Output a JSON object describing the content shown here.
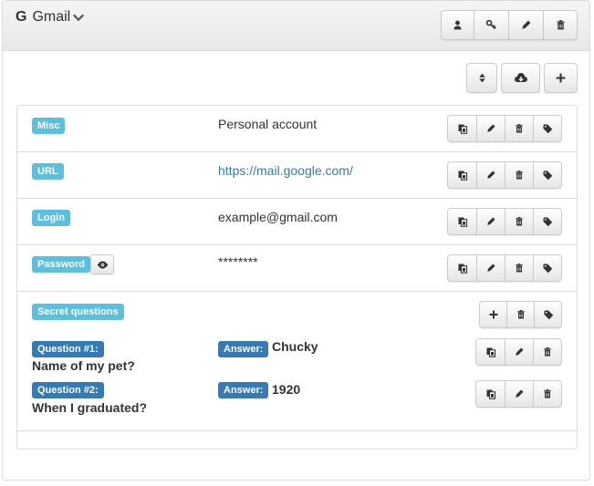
{
  "header": {
    "logo_letter": "G",
    "title": "Gmail"
  },
  "icons": {
    "header_buttons": [
      "user-icon",
      "key-icon",
      "pencil-icon",
      "trash-icon"
    ],
    "toolbar_buttons": [
      "sort-icon",
      "cloud-download-icon",
      "plus-icon"
    ],
    "row_actions": [
      "copy-icon",
      "pencil-icon",
      "trash-icon",
      "tag-icon"
    ],
    "secret_actions": [
      "plus-icon",
      "trash-icon",
      "tag-icon"
    ],
    "question_actions": [
      "copy-icon",
      "pencil-icon",
      "trash-icon"
    ]
  },
  "fields": [
    {
      "label": "Misc",
      "value": "Personal account"
    },
    {
      "label": "URL",
      "value": "https://mail.google.com/"
    },
    {
      "label": "Login",
      "value": "example@gmail.com"
    },
    {
      "label": "Password",
      "value": "********"
    }
  ],
  "secret_questions": {
    "label": "Secret questions",
    "answer_label": "Answer:",
    "items": [
      {
        "number_label": "Question #1:",
        "question": "Name of my pet?",
        "answer": "Chucky"
      },
      {
        "number_label": "Question #2:",
        "question": "When I graduated?",
        "answer": "1920"
      }
    ]
  },
  "colors": {
    "info": "#5bc0de",
    "primary": "#337ab7",
    "link": "#337ab7"
  }
}
